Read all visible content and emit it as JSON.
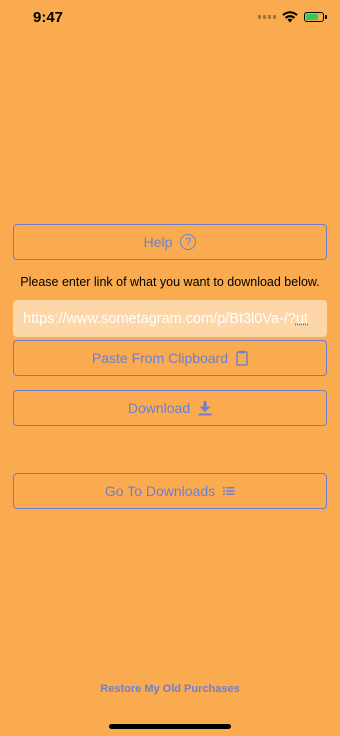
{
  "status_bar": {
    "time": "9:47",
    "icons": [
      "signal-icon",
      "wifi-icon",
      "battery-charging-icon"
    ]
  },
  "help_button": {
    "label": "Help",
    "icon": "question-circle-icon",
    "icon_glyph": "?"
  },
  "instruction_text": "Please enter link of what you want to download below.",
  "url_field": {
    "value_main": "https://www.sometagram.com/p/Bt3l0Va-/?",
    "value_tail": "ut"
  },
  "paste_button": {
    "label": "Paste From Clipboard",
    "icon": "clipboard-icon"
  },
  "download_button": {
    "label": "Download",
    "icon": "download-icon"
  },
  "downloads_button": {
    "label": "Go To Downloads",
    "icon": "list-icon"
  },
  "restore_link": {
    "label": "Restore My Old Purchases"
  },
  "colors": {
    "background": "#FBAB4F",
    "accent": "#6C7FD1",
    "input_background": "#FDD7A8"
  }
}
